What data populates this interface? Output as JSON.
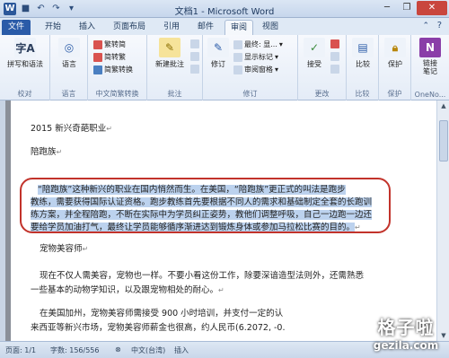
{
  "window": {
    "title": "文档1 - Microsoft Word",
    "app_icon": "W"
  },
  "tabs": [
    {
      "label": "文件"
    },
    {
      "label": "开始"
    },
    {
      "label": "插入"
    },
    {
      "label": "页面布局"
    },
    {
      "label": "引用"
    },
    {
      "label": "邮件"
    },
    {
      "label": "审阅"
    },
    {
      "label": "视图"
    }
  ],
  "ribbon": {
    "proofing": {
      "group": "校对",
      "spell": "拼写和语法",
      "lang_btn": "语言",
      "big_icon_text": "字A"
    },
    "language_group": {
      "group": "语言"
    },
    "chinese": {
      "group": "中文简繁转换",
      "to_simple": "繁转简",
      "to_trad": "简转繁",
      "convert": "简繁转换"
    },
    "comments": {
      "group": "批注",
      "new": "新建批注"
    },
    "tracking": {
      "group": "修订",
      "track": "修订",
      "markup": "最终: 显...",
      "show_markup": "显示标记",
      "review_pane": "审阅窗格"
    },
    "changes": {
      "group": "更改",
      "accept": "接受"
    },
    "compare": {
      "group": "比较",
      "compare": "比较"
    },
    "protect": {
      "group": "保护",
      "protect": "保护"
    },
    "onenote": {
      "group": "OneNo...",
      "linked": "链接\n笔记"
    }
  },
  "document": {
    "line1": "2015 新兴奇葩职业",
    "line2": "陪跑族",
    "sel1": "“陪跑族”这种新兴的职业在国内悄然而生。在美国，“陪跑族”更正式的叫法是跑步",
    "sel2": "教练，需要获得国际认证资格。跑步教练首先要根据不同人的需求和基础制定全套的长跑训",
    "sel3": "练方案，并全程陪跑，不断在实际中为学员纠正姿势，教他们调整呼吸，自己一边跑一边还",
    "sel4": "要给学员加油打气，最终让学员能够循序渐进达到锻炼身体或参加马拉松比赛的目的。",
    "line7": "宠物美容师",
    "line8": "现在不仅人需美容，宠物也一样。不要小看这份工作，除要深谙造型法则外，还需熟悉",
    "line9": "一些基本的动物学知识，以及跟宠物相处的耐心。",
    "line10": "在美国加州，宠物美容师需接受 900 小时培训，并支付一定的认",
    "line11": "来西亚等新兴市场，宠物美容师薪金也很高，约人民币(6.2072, -0."
  },
  "status": {
    "page": "页面: 1/1",
    "words": "字数: 156/556",
    "language": "中文(台湾)",
    "mode": "插入"
  },
  "watermark": {
    "big": "格子啦",
    "small": "gezila.com"
  },
  "colors": {
    "file_tab": "#2a5ba8",
    "selection": "#bcd2ee",
    "annotation": "#c2332b"
  }
}
